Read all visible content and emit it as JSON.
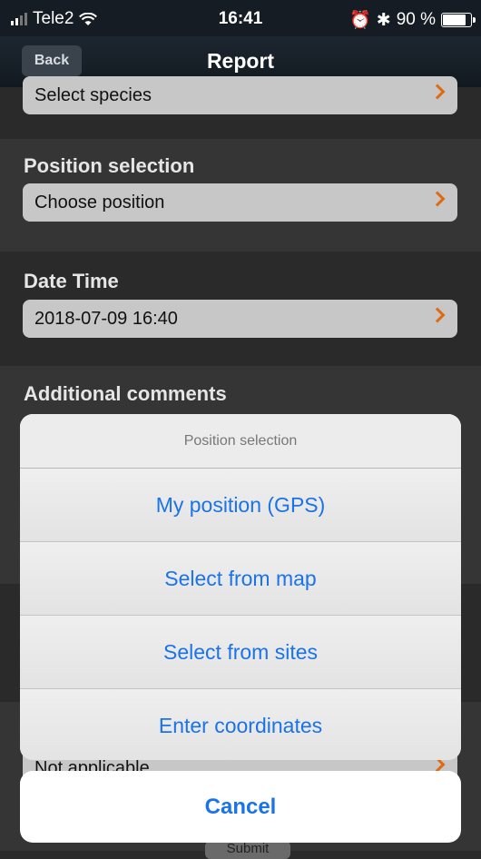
{
  "status_bar": {
    "carrier": "Tele2",
    "time": "16:41",
    "battery": "90 %",
    "battery_level": 0.9
  },
  "nav": {
    "back_label": "Back",
    "title": "Report"
  },
  "form": {
    "species_value": "Select species",
    "position_label": "Position selection",
    "position_value": "Choose position",
    "datetime_label": "Date  Time",
    "datetime_value": "2018-07-09  16:40",
    "comments_label": "Additional comments",
    "lower_value": "Not applicable",
    "submit_label": "Submit"
  },
  "action_sheet": {
    "title": "Position selection",
    "options": [
      "My position (GPS)",
      "Select from map",
      "Select from sites",
      "Enter coordinates"
    ],
    "cancel_label": "Cancel"
  },
  "colors": {
    "accent_blue": "#1a73e8",
    "chevron_orange": "#e06a12"
  }
}
